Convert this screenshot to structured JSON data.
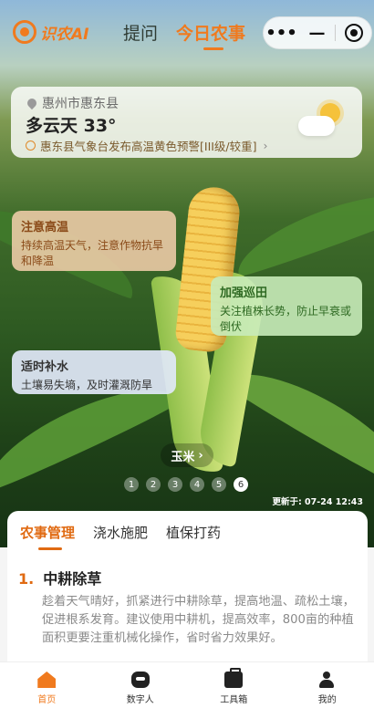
{
  "header": {
    "logo_text": "识农AI",
    "tabs": [
      {
        "label": "提问",
        "active": false
      },
      {
        "label": "今日农事",
        "active": true
      }
    ],
    "capsule": {
      "more": "•••",
      "minimize": "—"
    }
  },
  "weather": {
    "location": "惠州市惠东县",
    "condition_temp": "多云天  33°",
    "warning": "惠东县气象台发布高温黄色预警[III级/较重]",
    "warning_chevron": "›",
    "icon": "sun-cloud-icon"
  },
  "tips": [
    {
      "title": "注意高温",
      "text": "持续高温天气，注意作物抗旱和降温"
    },
    {
      "title": "加强巡田",
      "text": "关注植株长势，防止早衰或倒伏"
    },
    {
      "title": "适时补水",
      "text": "土壤易失墒，及时灌溉防旱"
    }
  ],
  "crop": {
    "label": "玉米",
    "chevron": "›"
  },
  "pager": {
    "pages": [
      "1",
      "2",
      "3",
      "4",
      "5",
      "6"
    ],
    "active_index": 5
  },
  "updated": "更新于:  07-24 12:43",
  "management": {
    "tabs": [
      {
        "label": "农事管理",
        "active": true
      },
      {
        "label": "浇水施肥",
        "active": false
      },
      {
        "label": "植保打药",
        "active": false
      }
    ],
    "items": [
      {
        "number": "1.",
        "title": "中耕除草",
        "text": "趁着天气晴好，抓紧进行中耕除草，提高地温、疏松土壤，促进根系发育。建议使用中耕机，提高效率，800亩的种植面积更要注重机械化操作，省时省力效果好。"
      }
    ]
  },
  "bottom_nav": [
    {
      "label": "首页",
      "icon": "home-icon",
      "active": true
    },
    {
      "label": "数字人",
      "icon": "robot-icon",
      "active": false
    },
    {
      "label": "工具箱",
      "icon": "toolbox-icon",
      "active": false
    },
    {
      "label": "我的",
      "icon": "user-icon",
      "active": false
    }
  ],
  "colors": {
    "accent": "#f07a1e",
    "hot_tip_bg": "#f0cdaa",
    "patrol_tip_bg": "#c8ebb9",
    "water_tip_bg": "#e1e8f8"
  }
}
